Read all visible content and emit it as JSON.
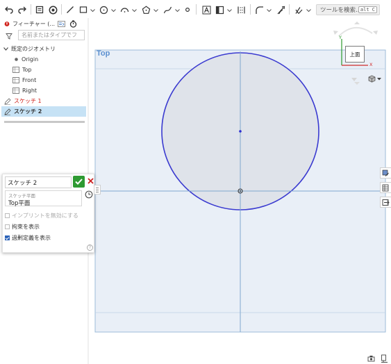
{
  "toolbar": {
    "tool_search_placeholder": "ツールを検索...",
    "tool_search_shortcut": "alt C",
    "icons": [
      "undo-icon",
      "redo-icon",
      "sketch-icon",
      "snap-icon",
      "line-icon",
      "rectangle-icon",
      "circle-icon",
      "arc-icon",
      "polygon-icon",
      "spline-icon",
      "point-icon",
      "text-icon",
      "image-icon",
      "construction-icon",
      "fillet-icon",
      "offset-icon",
      "trim-icon"
    ]
  },
  "feature_tree": {
    "header_label": "フィーチャー (...",
    "filter_placeholder": "名前またはタイプでフ",
    "default_geometry_label": "既定のジオメトリ",
    "items": [
      {
        "label": "Origin",
        "icon": "origin-point-icon"
      },
      {
        "label": "Top",
        "icon": "plane-icon"
      },
      {
        "label": "Front",
        "icon": "plane-icon"
      },
      {
        "label": "Right",
        "icon": "plane-icon"
      }
    ],
    "sketches": [
      {
        "label": "スケッチ 1",
        "color": "#d0231c",
        "selected": false
      },
      {
        "label": "スケッチ 2",
        "color": "#111111",
        "selected": true
      }
    ]
  },
  "sketch_dialog": {
    "name_value": "スケッチ 2",
    "plane_caption": "スケッチ平面",
    "plane_value": "Top平面",
    "options": [
      {
        "label": "インプリントを無効にする",
        "checked": false,
        "enabled": false
      },
      {
        "label": "拘束を表示",
        "checked": false,
        "enabled": true
      },
      {
        "label": "過剰定義を表示",
        "checked": true,
        "enabled": true
      }
    ],
    "help_label": "?"
  },
  "viewport": {
    "plane_label": "Top",
    "view_cube_face": "上面",
    "axis_x_label": "X",
    "axis_y_label": "Y",
    "colors": {
      "plane_fill": "#e9eff7",
      "plane_border": "#9dbbd8",
      "circle_stroke": "#3a3ad0",
      "circle_fill": "#dfe3ea",
      "axis_line": "#7fa7cf"
    }
  }
}
